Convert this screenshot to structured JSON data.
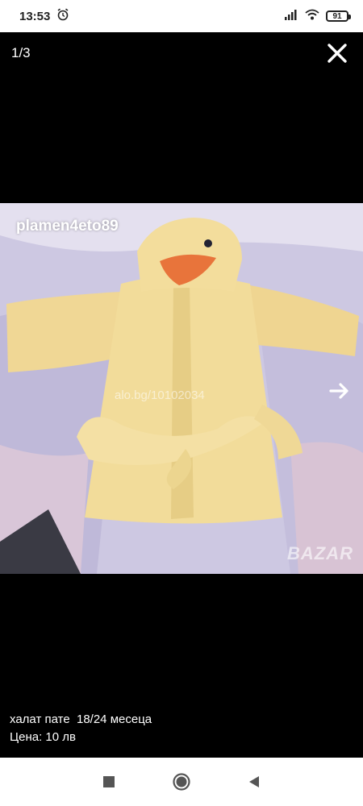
{
  "status_bar": {
    "time": "13:53",
    "battery": "91",
    "icons": [
      "alarm-icon",
      "signal-icon",
      "wifi-icon",
      "battery-icon"
    ]
  },
  "viewer": {
    "counter": "1/3",
    "close_icon": "close-icon",
    "next_icon": "arrow-right-icon"
  },
  "photo": {
    "watermark_user": "plamen4eto89",
    "watermark_site": "alo.bg/10102034",
    "watermark_brand": "BAZAR"
  },
  "caption": {
    "title": "халат пате  18/24 месеца",
    "price": "Цена: 10 лв"
  },
  "nav_bar": {
    "icons": [
      "recents-square-icon",
      "home-circle-icon",
      "back-triangle-icon"
    ]
  },
  "colors": {
    "background": "#000000",
    "robe": "#f2dc9a",
    "beak": "#e8743b",
    "blanket": "#cfc9e6"
  }
}
